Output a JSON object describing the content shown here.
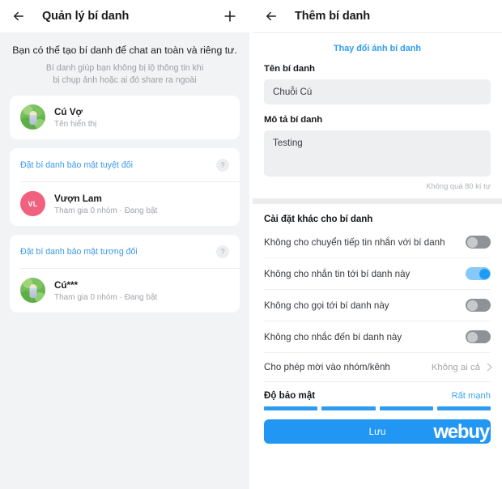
{
  "left": {
    "appbar": {
      "back_icon": "back-arrow-icon",
      "title": "Quản lý bí danh",
      "add_icon": "plus-icon"
    },
    "intro": {
      "title": "Bạn có thể tạo bí danh để chat an toàn và riêng tư.",
      "sub_line1": "Bí danh giúp bạn không bị lộ thông tin khi",
      "sub_line2": "bị chụp ảnh hoặc ai đó share ra ngoài"
    },
    "profile_card": {
      "name": "Cú Vợ",
      "sub": "Tên hiển thị",
      "avatar_kind": "photo"
    },
    "groups": [
      {
        "link": "Đặt bí danh bảo mật tuyệt đối",
        "help": "?",
        "alias": {
          "name": "Vượn Lam",
          "sub": "Tham gia 0 nhóm · Đang bật",
          "avatar_kind": "initials",
          "initials": "VL",
          "avatar_color": "#f1607f"
        }
      },
      {
        "link": "Đặt bí danh bảo mật tương đối",
        "help": "?",
        "alias": {
          "name": "Cú***",
          "sub": "Tham gia 0 nhóm · Đang bật",
          "avatar_kind": "photo",
          "initials": "",
          "avatar_color": "#6bbf52"
        }
      }
    ]
  },
  "right": {
    "appbar": {
      "back_icon": "back-arrow-icon",
      "title": "Thêm bí danh"
    },
    "change_photo_label": "Thay đổi ảnh bí danh",
    "name_field": {
      "label": "Tên bí danh",
      "value": "Chuỗi Cú",
      "placeholder": "Tên bí danh"
    },
    "desc_field": {
      "label": "Mô tả bí danh",
      "value": "Testing",
      "placeholder": "Mô tả bí danh",
      "hint": "Không quá 80 kí tự"
    },
    "settings": {
      "title": "Cài đặt khác cho bí danh",
      "rows": [
        {
          "label": "Không cho chuyển tiếp tin nhắn với bí danh",
          "type": "toggle",
          "on": false
        },
        {
          "label": "Không cho nhắn tin tới bí danh này",
          "type": "toggle",
          "on": true
        },
        {
          "label": "Không cho gọi tới bí danh này",
          "type": "toggle",
          "on": false
        },
        {
          "label": "Không cho nhắc đến bí danh này",
          "type": "toggle",
          "on": false
        },
        {
          "label": "Cho phép mời vào nhóm/kênh",
          "type": "value",
          "value": "Không ai cả"
        }
      ]
    },
    "strength": {
      "label": "Độ bảo mật",
      "value": "Rất mạnh",
      "segments": 4,
      "filled": 4,
      "color": "#2b9cf0"
    },
    "save_label": "Lưu",
    "watermark": "webuy"
  }
}
